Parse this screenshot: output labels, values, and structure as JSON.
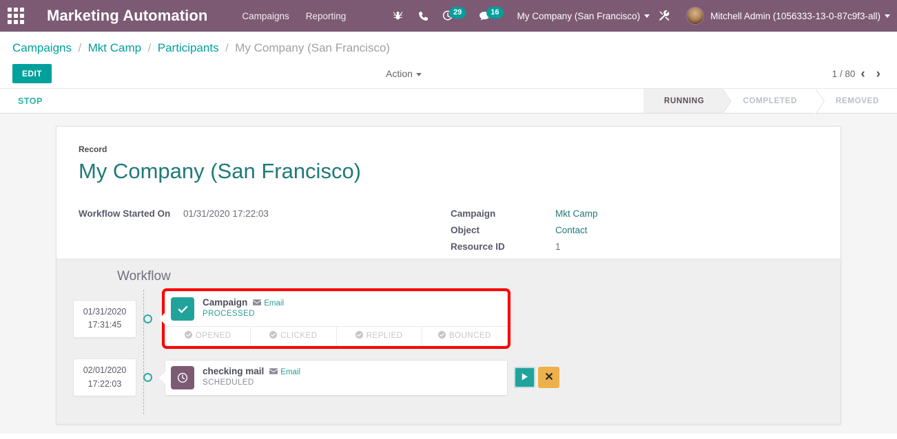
{
  "navbar": {
    "apps_icon": "apps-grid-icon",
    "app_title": "Marketing Automation",
    "menu": [
      {
        "label": "Campaigns"
      },
      {
        "label": "Reporting"
      }
    ],
    "icons": [
      {
        "name": "bug-icon"
      },
      {
        "name": "phone-icon"
      }
    ],
    "activity_count": "29",
    "messages_count": "16",
    "company": "My Company (San Francisco)",
    "tools_icon": "tools-icon",
    "user": "Mitchell Admin (1056333-13-0-87c9f3-all)",
    "accent_color": "#7C5A74",
    "badge_color": "#00A09D"
  },
  "breadcrumb": {
    "items": [
      {
        "label": "Campaigns",
        "active": false
      },
      {
        "label": "Mkt Camp",
        "active": false
      },
      {
        "label": "Participants",
        "active": false
      },
      {
        "label": "My Company (San Francisco)",
        "active": true
      }
    ],
    "separator": "/"
  },
  "control_panel": {
    "edit_label": "EDIT",
    "action_label": "Action",
    "pager": "1 / 80",
    "prev_icon": "chevron-left-icon",
    "next_icon": "chevron-right-icon"
  },
  "statusbar": {
    "stop_label": "STOP",
    "steps": [
      {
        "label": "RUNNING",
        "active": true
      },
      {
        "label": "COMPLETED",
        "active": false
      },
      {
        "label": "REMOVED",
        "active": false
      }
    ]
  },
  "record": {
    "record_label": "Record",
    "title": "My Company (San Francisco)",
    "left_fields": [
      {
        "label": "Workflow Started On",
        "value": "01/31/2020 17:22:03",
        "link": false
      }
    ],
    "right_fields": [
      {
        "label": "Campaign",
        "value": "Mkt Camp",
        "link": true
      },
      {
        "label": "Object",
        "value": "Contact",
        "link": true
      },
      {
        "label": "Resource ID",
        "value": "1",
        "link": false
      }
    ]
  },
  "workflow": {
    "heading": "Workflow",
    "rows": [
      {
        "date_line1": "01/31/2020",
        "date_line2": "17:31:45",
        "badge_icon": "check-icon",
        "badge_kind": "processed",
        "title": "Campaign",
        "kind_icon": "envelope-icon",
        "kind": "Email",
        "state": "PROCESSED",
        "highlighted": true,
        "metrics": [
          {
            "label": "OPENED",
            "icon": "check-circle-icon"
          },
          {
            "label": "CLICKED",
            "icon": "check-circle-icon"
          },
          {
            "label": "REPLIED",
            "icon": "check-circle-icon"
          },
          {
            "label": "BOUNCED",
            "icon": "check-circle-icon"
          }
        ],
        "actions": []
      },
      {
        "date_line1": "02/01/2020",
        "date_line2": "17:22:03",
        "badge_icon": "clock-icon",
        "badge_kind": "scheduled",
        "title": "checking mail",
        "kind_icon": "envelope-icon",
        "kind": "Email",
        "state": "SCHEDULED",
        "highlighted": false,
        "metrics": [],
        "actions": [
          {
            "name": "run-now-button",
            "icon": "play-icon",
            "style": "run"
          },
          {
            "name": "cancel-button",
            "icon": "close-icon",
            "style": "cancel"
          }
        ]
      }
    ]
  }
}
